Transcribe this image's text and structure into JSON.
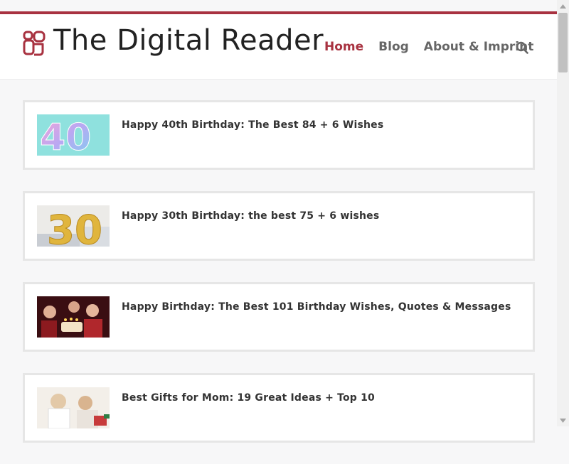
{
  "site": {
    "logo_text": "The Digital Reader",
    "accent_color": "#a83240"
  },
  "nav": {
    "items": [
      {
        "label": "Home",
        "active": true
      },
      {
        "label": "Blog",
        "active": false
      },
      {
        "label": "About & Imprint",
        "active": false
      }
    ],
    "search_icon": "search-icon"
  },
  "posts": [
    {
      "title": "Happy 40th Birthday: The Best 84 + 6 Wishes",
      "thumb": "balloons-40"
    },
    {
      "title": "Happy 30th Birthday: the best 75 + 6 wishes",
      "thumb": "balloons-30"
    },
    {
      "title": "Happy Birthday: The Best 101 Birthday Wishes, Quotes & Messages",
      "thumb": "party-photo"
    },
    {
      "title": "Best Gifts for Mom: 19 Great Ideas + Top 10",
      "thumb": "mom-gift-photo"
    }
  ]
}
